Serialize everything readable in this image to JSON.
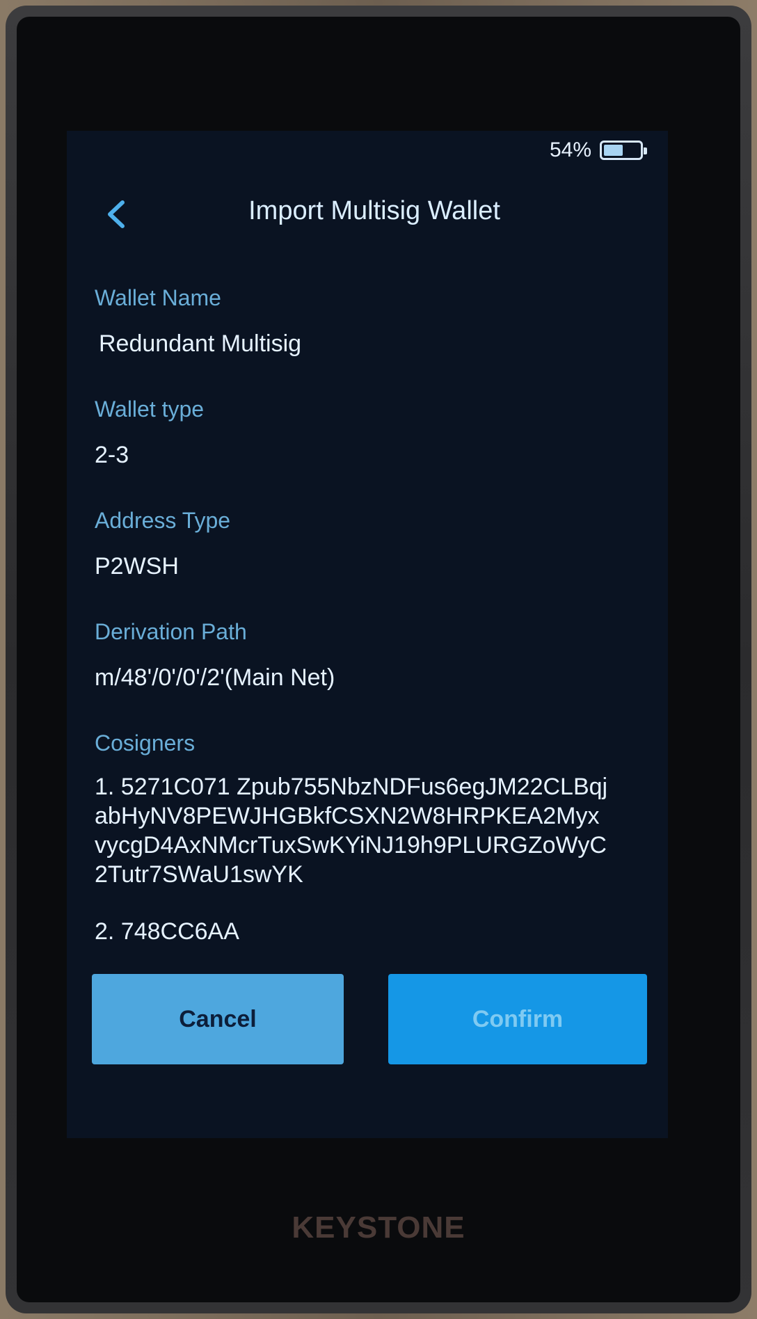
{
  "status_bar": {
    "battery_percent": "54%",
    "battery_level": 0.54,
    "battery_icon": "battery-icon"
  },
  "header": {
    "title": "Import Multisig Wallet",
    "back_icon": "chevron-left-icon"
  },
  "fields": {
    "wallet_name_label": "Wallet Name",
    "wallet_name_value": "Redundant Multisig",
    "wallet_type_label": "Wallet type",
    "wallet_type_value": "2-3",
    "address_type_label": "Address Type",
    "address_type_value": "P2WSH",
    "derivation_path_label": "Derivation Path",
    "derivation_path_value": "m/48'/0'/0'/2'(Main Net)",
    "cosigners_label": "Cosigners"
  },
  "cosigners": [
    {
      "text": "1. 5271C071 Zpub755NbzNDFus6egJM22CLBqjabHyNV8PEWJHGBkfCSXN2W8HRPKEA2MyxvycgD4AxNMcrTuxSwKYiNJ19h9PLURGZoWyC2Tutr7SWaU1swYK"
    },
    {
      "text": "2. 748CC6AA"
    }
  ],
  "footer": {
    "cancel_label": "Cancel",
    "confirm_label": "Confirm"
  },
  "device": {
    "brand": "KEYSTONE"
  },
  "colors": {
    "accent": "#1597e6",
    "label": "#6aaed8",
    "screen_bg": "#0a1322"
  }
}
